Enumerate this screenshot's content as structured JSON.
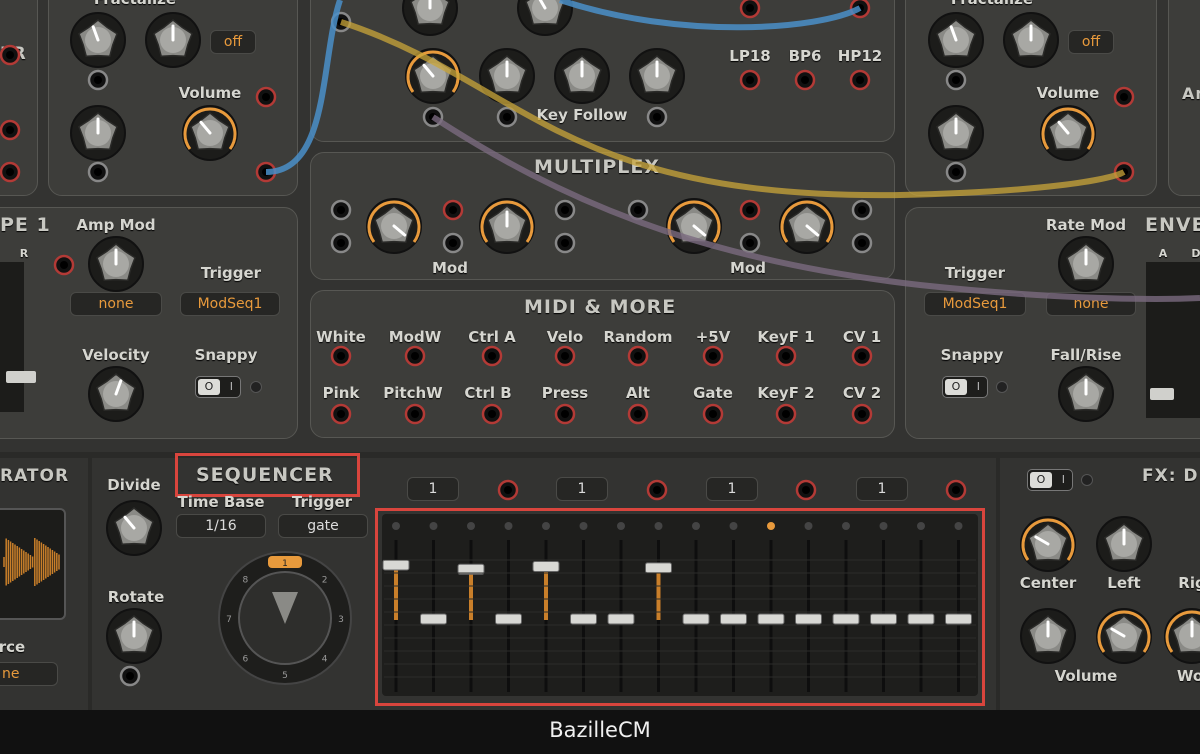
{
  "footer": {
    "app_name": "BazilleCM"
  },
  "osc_left": {
    "fractalize_label": "Fractalize",
    "off_value": "off",
    "volume_label": "Volume",
    "side_text": "ER"
  },
  "filter": {
    "modes": [
      "LP18",
      "BP6",
      "HP12"
    ],
    "key_follow_label": "Key Follow"
  },
  "osc_right": {
    "fractalize_label": "Fractalize",
    "off_value": "off",
    "volume_label": "Volume",
    "side_text": "Am"
  },
  "env_left": {
    "title": "PE 1",
    "r_label": "R",
    "amp_mod_label": "Amp Mod",
    "amp_mod_value": "none",
    "trigger_label": "Trigger",
    "trigger_value": "ModSeq1",
    "velocity_label": "Velocity",
    "snappy_label": "Snappy"
  },
  "multiplex": {
    "title": "MULTIPLEX",
    "mod_label_1": "Mod",
    "mod_label_2": "Mod"
  },
  "midi_more": {
    "title": "MIDI & MORE",
    "row1": [
      "White",
      "ModW",
      "Ctrl A",
      "Velo",
      "Random",
      "+5V",
      "KeyF 1",
      "CV 1"
    ],
    "row2": [
      "Pink",
      "PitchW",
      "Ctrl B",
      "Press",
      "Alt",
      "Gate",
      "KeyF 2",
      "CV 2"
    ]
  },
  "env_right": {
    "title": "ENVE",
    "a_label": "A",
    "d_label": "D",
    "rate_mod_label": "Rate Mod",
    "rate_mod_value": "none",
    "trigger_label": "Trigger",
    "trigger_value": "ModSeq1",
    "snappy_label": "Snappy",
    "fall_rise_label": "Fall/Rise"
  },
  "generator": {
    "title_fragment": "RATOR",
    "source_label": "rce",
    "source_value": "ne"
  },
  "sequencer": {
    "title": "SEQUENCER",
    "divide_label": "Divide",
    "time_base_label": "Time Base",
    "time_base_value": "1/16",
    "trigger_label": "Trigger",
    "trigger_value": "gate",
    "rotate_label": "Rotate",
    "ring_numbers": [
      "1",
      "2",
      "3",
      "4",
      "5",
      "6",
      "7",
      "8"
    ],
    "group_values": [
      "1",
      "1",
      "1",
      "1"
    ],
    "step_values": [
      0.88,
      0.5,
      0.85,
      0.5,
      0.87,
      0.5,
      0.5,
      0.86,
      0.5,
      0.5,
      0.5,
      0.5,
      0.5,
      0.5,
      0.5,
      0.5
    ]
  },
  "fx": {
    "title": "FX: D",
    "center_label": "Center",
    "left_label": "Left",
    "right_label": "Rig",
    "volume_label": "Volume",
    "w_label": "Wo"
  },
  "colors": {
    "accent": "#e89a3c",
    "highlight": "#d9453d",
    "cable_blue": "#4a8fc9",
    "cable_yellow": "#c9a53a",
    "cable_purple": "#7a6a80"
  }
}
